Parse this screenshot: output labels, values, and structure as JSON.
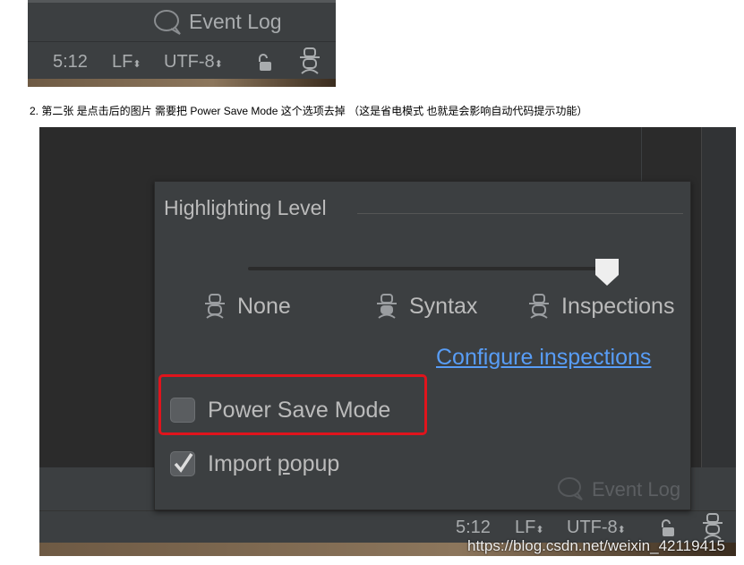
{
  "top_screenshot": {
    "event_log": "Event Log",
    "position": "5:12",
    "line_separator": "LF",
    "encoding": "UTF-8",
    "icons": [
      "speech-bubble-icon",
      "unlock-icon",
      "hector-inspector-icon",
      "updown-arrows-icon"
    ]
  },
  "caption": "2. 第二张  是点击后的图片  需要把  Power Save  Mode 这个选项去掉  （这是省电模式 也就是会影响自动代码提示功能）",
  "popup": {
    "title": "Highlighting Level",
    "slider": {
      "levels": [
        "None",
        "Syntax",
        "Inspections"
      ],
      "selected": "Inspections",
      "value_index": 2
    },
    "configure_link": "Configure inspections",
    "power_save": {
      "label": "Power Save Mode",
      "checked": false
    },
    "import_popup": {
      "label_pre": "Import ",
      "label_u": "p",
      "label_post": "opup",
      "checked": true
    },
    "highlight_color": "#e0141c",
    "link_color": "#589df6"
  },
  "bottom_status": {
    "event_log": "Event Log",
    "position": "5:12",
    "line_separator": "LF",
    "encoding": "UTF-8"
  },
  "watermark": "https://blog.csdn.net/weixin_42119415"
}
